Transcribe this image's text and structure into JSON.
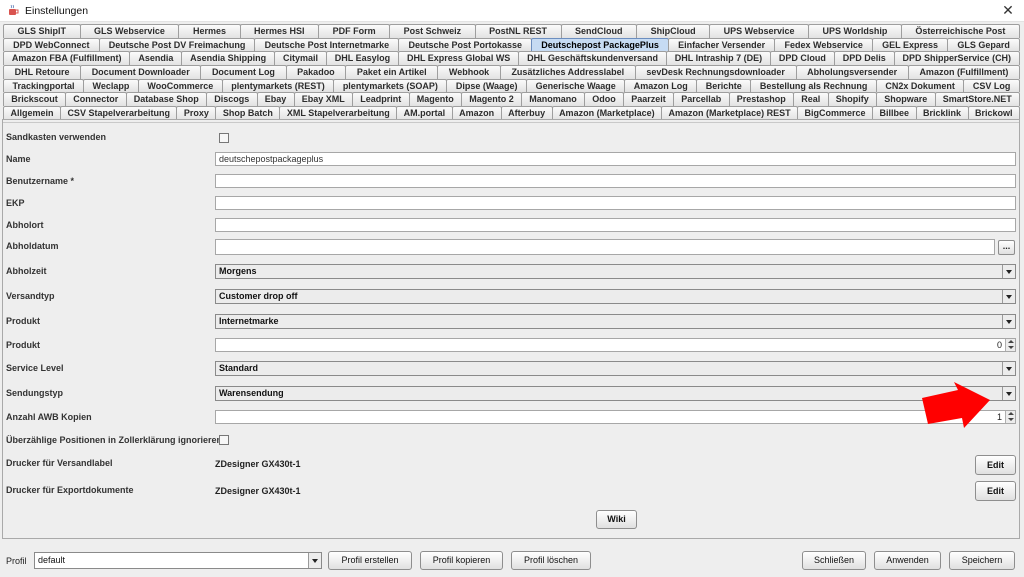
{
  "window": {
    "title": "Einstellungen",
    "close_glyph": "✕",
    "icon": "java-coffee-icon"
  },
  "tab_rows": [
    [
      "GLS ShipIT",
      "GLS Webservice",
      "Hermes",
      "Hermes HSI",
      "PDF Form",
      "Post Schweiz",
      "PostNL REST",
      "SendCloud",
      "ShipCloud",
      "UPS Webservice",
      "UPS Worldship",
      "Österreichische Post"
    ],
    [
      "DPD WebConnect",
      "Deutsche Post DV Freimachung",
      "Deutsche Post Internetmarke",
      "Deutsche Post Portokasse",
      "Deutschepost PackagePlus",
      "Einfacher Versender",
      "Fedex Webservice",
      "GEL Express",
      "GLS Gepard"
    ],
    [
      "Amazon FBA (Fulfillment)",
      "Asendia",
      "Asendia Shipping",
      "Citymail",
      "DHL Easylog",
      "DHL Express Global WS",
      "DHL Geschäftskundenversand",
      "DHL Intraship 7 (DE)",
      "DPD Cloud",
      "DPD Delis",
      "DPD ShipperService (CH)"
    ],
    [
      "DHL Retoure",
      "Document Downloader",
      "Document Log",
      "Pakadoo",
      "Paket ein Artikel",
      "Webhook",
      "Zusätzliches Addresslabel",
      "sevDesk Rechnungsdownloader",
      "Abholungsversender",
      "Amazon (Fulfillment)"
    ],
    [
      "Trackingportal",
      "Weclapp",
      "WooCommerce",
      "plentymarkets (REST)",
      "plentymarkets (SOAP)",
      "Dipse (Waage)",
      "Generische Waage",
      "Amazon Log",
      "Berichte",
      "Bestellung als Rechnung",
      "CN2x Dokument",
      "CSV Log"
    ],
    [
      "Brickscout",
      "Connector",
      "Database Shop",
      "Discogs",
      "Ebay",
      "Ebay XML",
      "Leadprint",
      "Magento",
      "Magento 2",
      "Manomano",
      "Odoo",
      "Paarzeit",
      "Parcellab",
      "Prestashop",
      "Real",
      "Shopify",
      "Shopware",
      "SmartStore.NET"
    ],
    [
      "Allgemein",
      "CSV Stapelverarbeitung",
      "Proxy",
      "Shop Batch",
      "XML Stapelverarbeitung",
      "AM.portal",
      "Amazon",
      "Afterbuy",
      "Amazon (Marketplace)",
      "Amazon (Marketplace) REST",
      "BigCommerce",
      "Billbee",
      "Bricklink",
      "Brickowl"
    ]
  ],
  "active_tab": "Deutschepost PackagePlus",
  "form": {
    "sandkasten_label": "Sandkasten verwenden",
    "sandkasten_checked": false,
    "name_label": "Name",
    "name_value": "deutschepostpackageplus",
    "benutzername_label": "Benutzername *",
    "benutzername_value": "",
    "ekp_label": "EKP",
    "ekp_value": "",
    "abholort_label": "Abholort",
    "abholort_value": "",
    "abholdatum_label": "Abholdatum",
    "abholdatum_value": "",
    "abholdatum_button": "...",
    "abholzeit_label": "Abholzeit",
    "abholzeit_value": "Morgens",
    "versandtyp_label": "Versandtyp",
    "versandtyp_value": "Customer drop off",
    "produkt_select_label": "Produkt",
    "produkt_select_value": "Internetmarke",
    "produkt_qty_label": "Produkt",
    "produkt_qty_value": "0",
    "service_level_label": "Service Level",
    "service_level_value": "Standard",
    "sendungstyp_label": "Sendungstyp",
    "sendungstyp_value": "Warensendung",
    "awb_label": "Anzahl AWB Kopien",
    "awb_value": "1",
    "zoll_label": "Überzählige Positionen in Zollerklärung ignorieren",
    "zoll_checked": false,
    "drucker_versand_label": "Drucker für Versandlabel",
    "drucker_versand_value": "ZDesigner GX430t-1",
    "drucker_export_label": "Drucker für Exportdokumente",
    "drucker_export_value": "ZDesigner GX430t-1",
    "edit_label": "Edit",
    "wiki_label": "Wiki"
  },
  "footer": {
    "profil_label": "Profil",
    "profil_value": "default",
    "profil_erstellen": "Profil erstellen",
    "profil_kopieren": "Profil kopieren",
    "profil_loeschen": "Profil löschen",
    "schliessen": "Schließen",
    "anwenden": "Anwenden",
    "speichern": "Speichern"
  },
  "colors": {
    "annotation_arrow": "#ff0000",
    "active_tab": "#c6dbf3"
  }
}
